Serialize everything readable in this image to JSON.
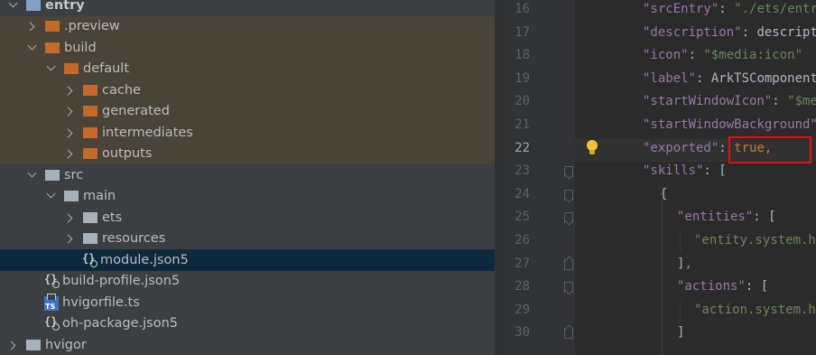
{
  "project_tree": {
    "items": [
      {
        "label": "entry",
        "depth": 0,
        "expanded": true,
        "icon": "module-folder-icon",
        "kind": "module",
        "bold": true
      },
      {
        "label": ".preview",
        "depth": 1,
        "expanded": false,
        "icon": "folder-orange-icon",
        "kind": "folder"
      },
      {
        "label": "build",
        "depth": 1,
        "expanded": true,
        "icon": "folder-orange-icon",
        "kind": "folder"
      },
      {
        "label": "default",
        "depth": 2,
        "expanded": true,
        "icon": "folder-orange-icon",
        "kind": "folder"
      },
      {
        "label": "cache",
        "depth": 3,
        "expanded": false,
        "icon": "folder-orange-icon",
        "kind": "folder"
      },
      {
        "label": "generated",
        "depth": 3,
        "expanded": false,
        "icon": "folder-orange-icon",
        "kind": "folder"
      },
      {
        "label": "intermediates",
        "depth": 3,
        "expanded": false,
        "icon": "folder-orange-icon",
        "kind": "folder"
      },
      {
        "label": "outputs",
        "depth": 3,
        "expanded": false,
        "icon": "folder-orange-icon",
        "kind": "folder"
      },
      {
        "label": "src",
        "depth": 1,
        "expanded": true,
        "icon": "folder-icon",
        "kind": "folder"
      },
      {
        "label": "main",
        "depth": 2,
        "expanded": true,
        "icon": "folder-icon",
        "kind": "folder"
      },
      {
        "label": "ets",
        "depth": 3,
        "expanded": false,
        "icon": "folder-icon",
        "kind": "folder"
      },
      {
        "label": "resources",
        "depth": 3,
        "expanded": false,
        "icon": "folder-icon",
        "kind": "folder"
      },
      {
        "label": "module.json5",
        "depth": 3,
        "icon": "json5-file-icon",
        "kind": "file",
        "selected": true
      },
      {
        "label": "build-profile.json5",
        "depth": 1,
        "icon": "json5-file-icon",
        "kind": "file"
      },
      {
        "label": "hvigorfile.ts",
        "depth": 1,
        "icon": "ts-file-icon",
        "kind": "file"
      },
      {
        "label": "oh-package.json5",
        "depth": 1,
        "icon": "json5-file-icon",
        "kind": "file"
      },
      {
        "label": "hvigor",
        "depth": 0,
        "expanded": false,
        "icon": "folder-icon",
        "kind": "folder"
      }
    ]
  },
  "editor": {
    "current_line": 22,
    "lines": [
      {
        "num": 16,
        "indent": 0,
        "tokens": [
          {
            "t": "\"srcEntry\"",
            "c": "k"
          },
          {
            "t": ": ",
            "c": "p"
          },
          {
            "t": "\"./ets/entryability/EntryAbility.ts\"",
            "c": "s"
          },
          {
            "t": ",",
            "c": "kw"
          }
        ]
      },
      {
        "num": 17,
        "indent": 0,
        "tokens": [
          {
            "t": "\"description\"",
            "c": "k"
          },
          {
            "t": ": ",
            "c": "p"
          },
          {
            "t": "description",
            "c": "p"
          }
        ]
      },
      {
        "num": 18,
        "indent": 0,
        "tokens": [
          {
            "t": "\"icon\"",
            "c": "k"
          },
          {
            "t": ": ",
            "c": "p"
          },
          {
            "t": "\"$media:icon\"",
            "c": "s"
          }
        ]
      },
      {
        "num": 19,
        "indent": 0,
        "tokens": [
          {
            "t": "\"label\"",
            "c": "k"
          },
          {
            "t": ": ",
            "c": "p"
          },
          {
            "t": "ArkTSComponent",
            "c": "p"
          }
        ]
      },
      {
        "num": 20,
        "indent": 0,
        "tokens": [
          {
            "t": "\"startWindowIcon\"",
            "c": "k"
          },
          {
            "t": ": ",
            "c": "p"
          },
          {
            "t": "\"$media:icon\"",
            "c": "s"
          }
        ]
      },
      {
        "num": 21,
        "indent": 0,
        "tokens": [
          {
            "t": "\"startWindowBackground\"",
            "c": "k"
          }
        ]
      },
      {
        "num": 22,
        "indent": 0,
        "tokens": [
          {
            "t": "\"exported\"",
            "c": "k"
          },
          {
            "t": ": ",
            "c": "p"
          },
          {
            "t": "true",
            "c": "kw"
          },
          {
            "t": ",",
            "c": "kw"
          }
        ]
      },
      {
        "num": 23,
        "indent": 0,
        "fold": "open",
        "tokens": [
          {
            "t": "\"skills\"",
            "c": "k"
          },
          {
            "t": ": [",
            "c": "p"
          }
        ]
      },
      {
        "num": 24,
        "indent": 1,
        "fold": "open",
        "tokens": [
          {
            "t": "{",
            "c": "p"
          }
        ]
      },
      {
        "num": 25,
        "indent": 2,
        "fold": "open",
        "tokens": [
          {
            "t": "\"entities\"",
            "c": "k"
          },
          {
            "t": ": [",
            "c": "p"
          }
        ]
      },
      {
        "num": 26,
        "indent": 3,
        "tokens": [
          {
            "t": "\"entity.system.home\"",
            "c": "s"
          }
        ]
      },
      {
        "num": 27,
        "indent": 2,
        "fold": "close",
        "tokens": [
          {
            "t": "]",
            "c": "p"
          },
          {
            "t": ",",
            "c": "kw"
          }
        ]
      },
      {
        "num": 28,
        "indent": 2,
        "fold": "open",
        "tokens": [
          {
            "t": "\"actions\"",
            "c": "k"
          },
          {
            "t": ": [",
            "c": "p"
          }
        ]
      },
      {
        "num": 29,
        "indent": 3,
        "tokens": [
          {
            "t": "\"action.system.home\"",
            "c": "s"
          }
        ]
      },
      {
        "num": 30,
        "indent": 2,
        "fold": "close",
        "tokens": [
          {
            "t": "]",
            "c": "p"
          }
        ]
      }
    ],
    "intention_icon": "lightbulb-icon"
  },
  "colors": {
    "highlight_box": "#e21212",
    "tree_highlight": "#4a4438",
    "selection": "#0d293e"
  }
}
